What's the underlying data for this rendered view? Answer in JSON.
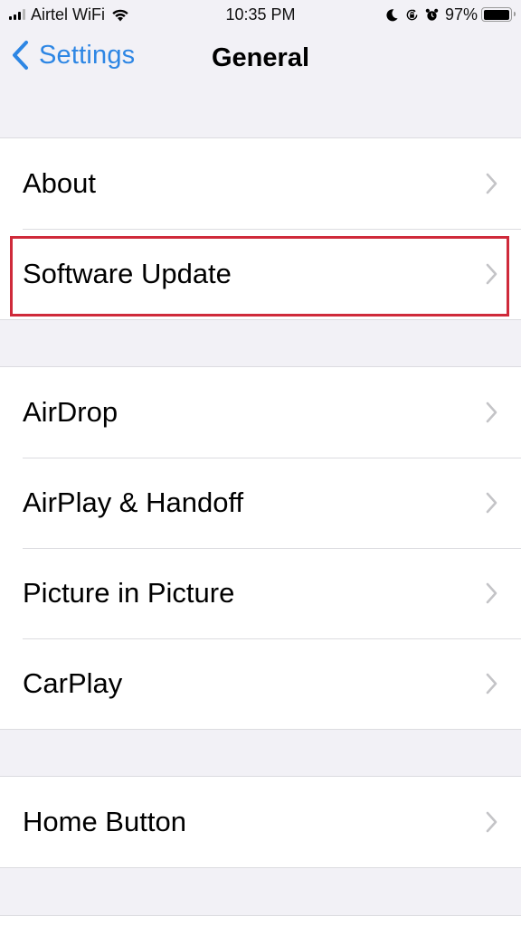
{
  "status_bar": {
    "carrier": "Airtel WiFi",
    "time": "10:35 PM",
    "battery_percent": "97%",
    "battery_level": 0.97,
    "icons": [
      "signal-icon",
      "wifi-icon",
      "moon-icon",
      "orientation-lock-icon",
      "alarm-icon",
      "battery-icon"
    ]
  },
  "nav": {
    "back_label": "Settings",
    "title": "General"
  },
  "groups": [
    {
      "items": [
        {
          "label": "About"
        },
        {
          "label": "Software Update",
          "highlighted": true
        }
      ]
    },
    {
      "items": [
        {
          "label": "AirDrop"
        },
        {
          "label": "AirPlay & Handoff"
        },
        {
          "label": "Picture in Picture"
        },
        {
          "label": "CarPlay"
        }
      ]
    },
    {
      "items": [
        {
          "label": "Home Button"
        }
      ]
    }
  ],
  "colors": {
    "accent": "#2d86e4",
    "highlight_border": "#cf2a3a",
    "background": "#f2f1f6",
    "chevron": "#c4c4c7"
  }
}
